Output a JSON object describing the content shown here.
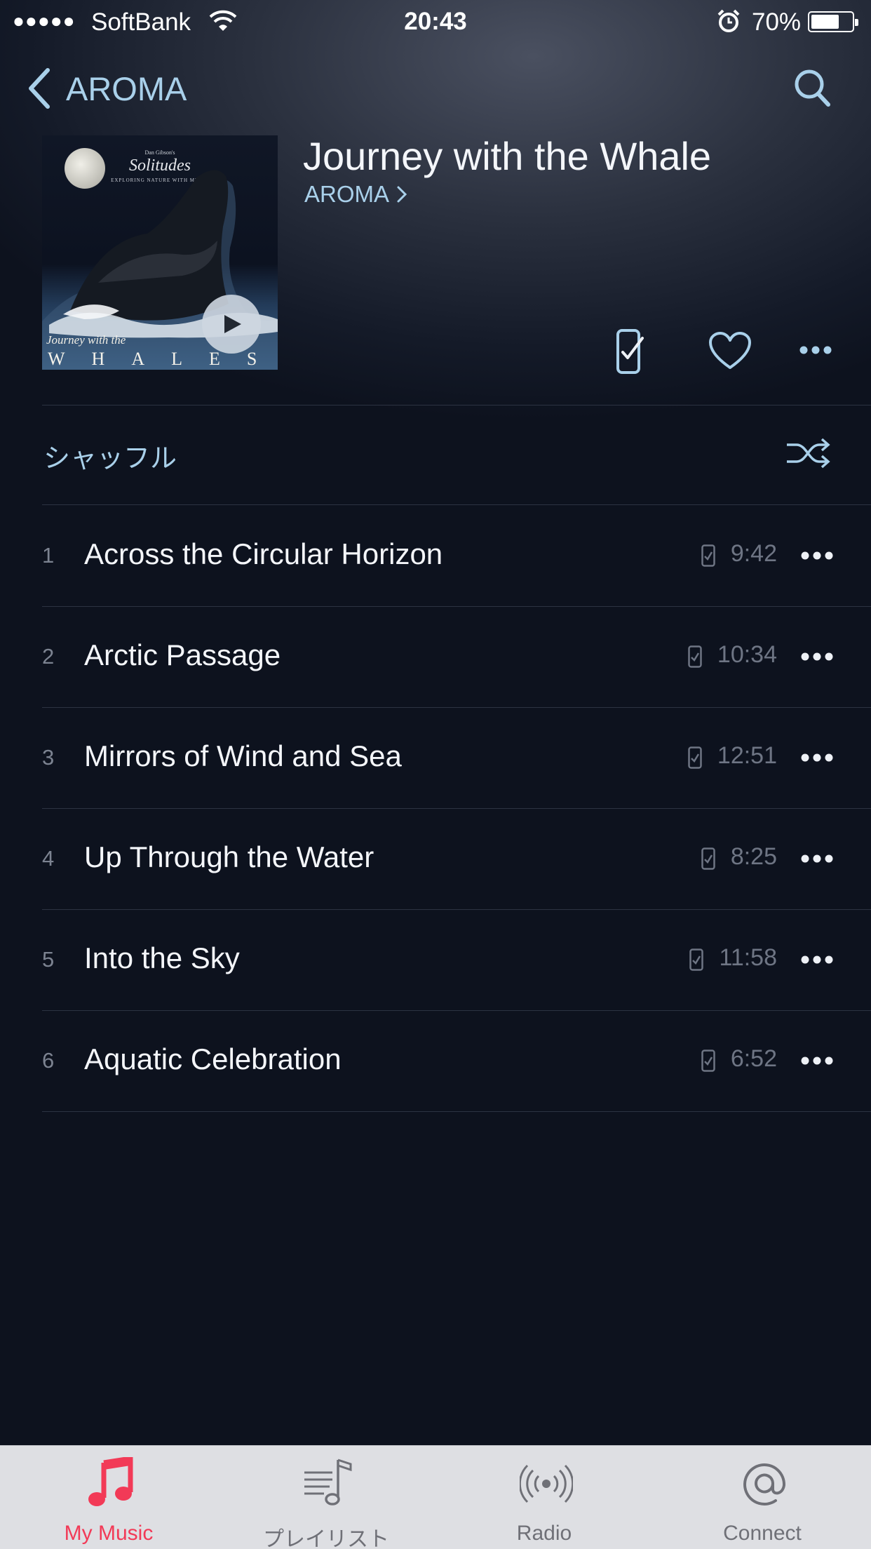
{
  "status_bar": {
    "signal": "●●●●●",
    "carrier": "SoftBank",
    "time": "20:43",
    "battery_percent": "70%",
    "battery_level": 0.7
  },
  "nav": {
    "back_label": "AROMA",
    "back_icon": "chevron-left-icon",
    "search_icon": "search-icon"
  },
  "album": {
    "title": "Journey with the Whale",
    "artist": "AROMA",
    "cover": {
      "brand": "Dan Gibson's",
      "logo": "Solitudes",
      "tagline": "EXPLORING NATURE WITH MUSIC",
      "subtitle": "Journey with the",
      "word": "WHALES"
    }
  },
  "shuffle": {
    "label": "シャッフル",
    "icon": "shuffle-icon"
  },
  "tracks": [
    {
      "number": "1",
      "title": "Across the Circular Horizon",
      "duration": "9:42"
    },
    {
      "number": "2",
      "title": "Arctic Passage",
      "duration": "10:34"
    },
    {
      "number": "3",
      "title": "Mirrors of Wind and Sea",
      "duration": "12:51"
    },
    {
      "number": "4",
      "title": "Up Through the Water",
      "duration": "8:25"
    },
    {
      "number": "5",
      "title": "Into the Sky",
      "duration": "11:58"
    },
    {
      "number": "6",
      "title": "Aquatic Celebration",
      "duration": "6:52"
    }
  ],
  "tab_bar": {
    "items": [
      {
        "label": "My Music",
        "icon": "music-note-icon",
        "active": true
      },
      {
        "label": "プレイリスト",
        "icon": "playlist-icon",
        "active": false
      },
      {
        "label": "Radio",
        "icon": "radio-icon",
        "active": false
      },
      {
        "label": "Connect",
        "icon": "at-sign-icon",
        "active": false
      }
    ]
  },
  "colors": {
    "background": "#0d121e",
    "accent": "#a9d0ea",
    "active_tab": "#f23a57",
    "tab_bar": "#dedfe3"
  }
}
